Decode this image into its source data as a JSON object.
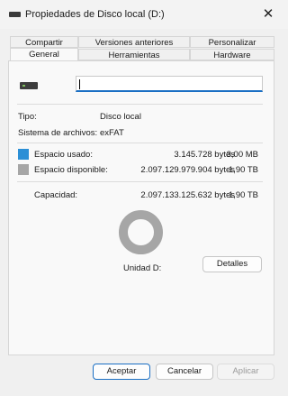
{
  "window": {
    "title": "Propiedades de Disco local (D:)",
    "close_glyph": "✕"
  },
  "tabs_row1": [
    "Compartir",
    "Versiones anteriores",
    "Personalizar"
  ],
  "tabs_row2": [
    "General",
    "Herramientas",
    "Hardware"
  ],
  "active_tab": "General",
  "drive": {
    "name_value": ""
  },
  "info": {
    "type_label": "Tipo:",
    "type_value": "Disco local",
    "fs_label": "Sistema de archivos:",
    "fs_value": "exFAT"
  },
  "space": {
    "used_label": "Espacio usado:",
    "used_bytes": "3.145.728 bytes",
    "used_short": "3,00 MB",
    "used_color": "#2b8fd6",
    "free_label": "Espacio disponible:",
    "free_bytes": "2.097.129.979.904 bytes",
    "free_short": "1,90 TB",
    "free_color": "#a6a6a6",
    "capacity_label": "Capacidad:",
    "capacity_bytes": "2.097.133.125.632 bytes",
    "capacity_short": "1,90 TB",
    "used_fraction": 1.5e-06
  },
  "drive_label": "Unidad D:",
  "buttons": {
    "details": "Detalles",
    "ok": "Aceptar",
    "cancel": "Cancelar",
    "apply": "Aplicar"
  }
}
